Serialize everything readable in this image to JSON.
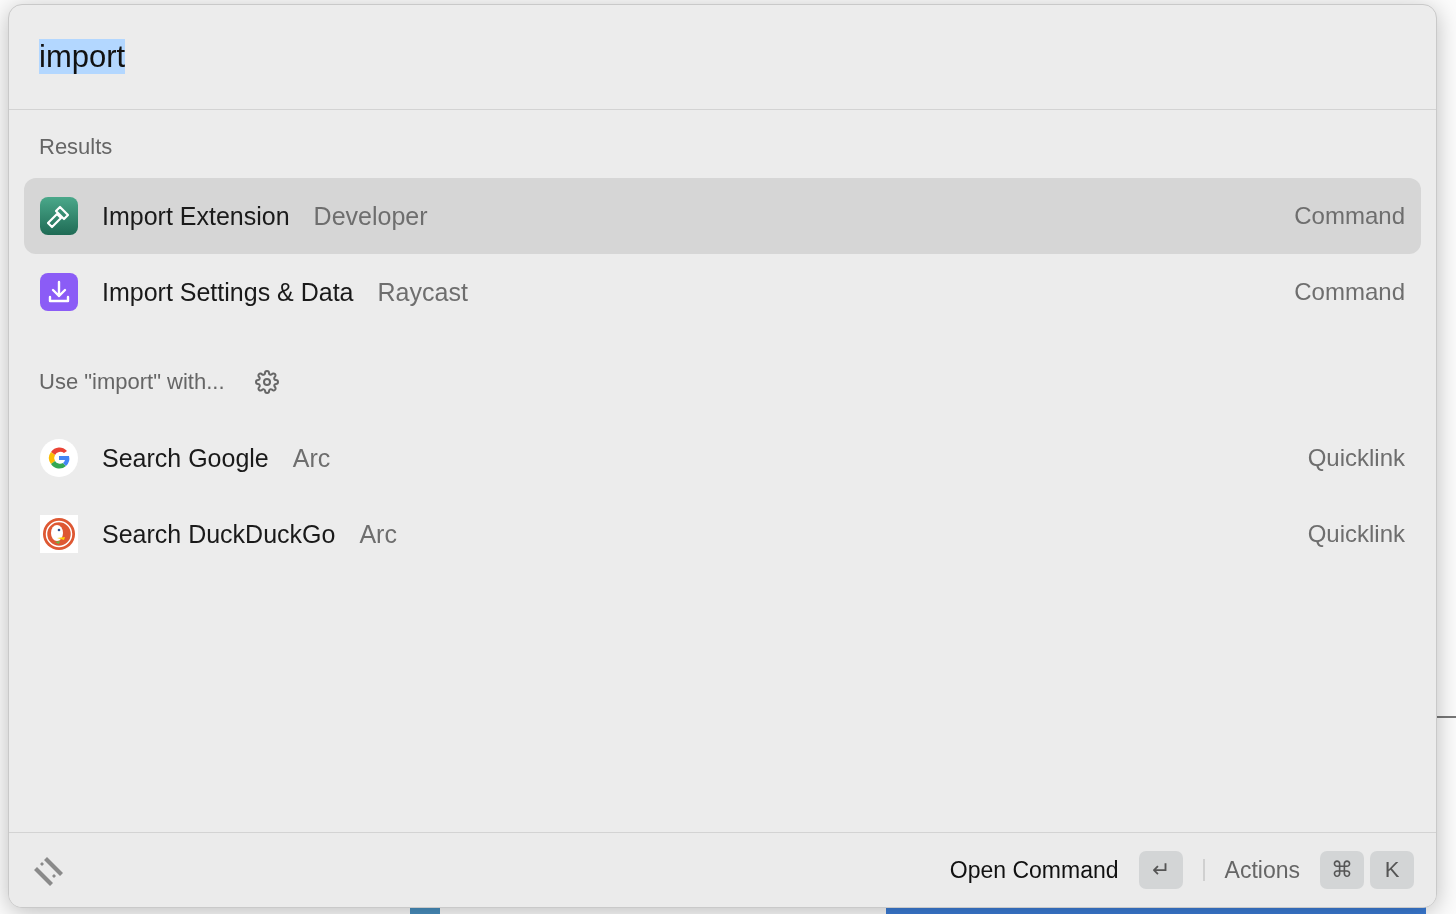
{
  "search": {
    "value": "import",
    "selected": true
  },
  "sections": [
    {
      "title": "Results",
      "settings": false,
      "items": [
        {
          "kind": "extension",
          "title": "Import Extension",
          "subtitle": "Developer",
          "accessory": "Command",
          "selected": true
        },
        {
          "kind": "download",
          "title": "Import Settings & Data",
          "subtitle": "Raycast",
          "accessory": "Command",
          "selected": false
        }
      ]
    },
    {
      "title": "Use \"import\" with...",
      "settings": true,
      "items": [
        {
          "kind": "google",
          "title": "Search Google",
          "subtitle": "Arc",
          "accessory": "Quicklink",
          "selected": false
        },
        {
          "kind": "duckduckgo",
          "title": "Search DuckDuckGo",
          "subtitle": "Arc",
          "accessory": "Quicklink",
          "selected": false
        }
      ]
    }
  ],
  "footer": {
    "primary": {
      "label": "Open Command",
      "keys": [
        "↵"
      ]
    },
    "secondary": {
      "label": "Actions",
      "keys": [
        "⌘",
        "K"
      ]
    }
  }
}
